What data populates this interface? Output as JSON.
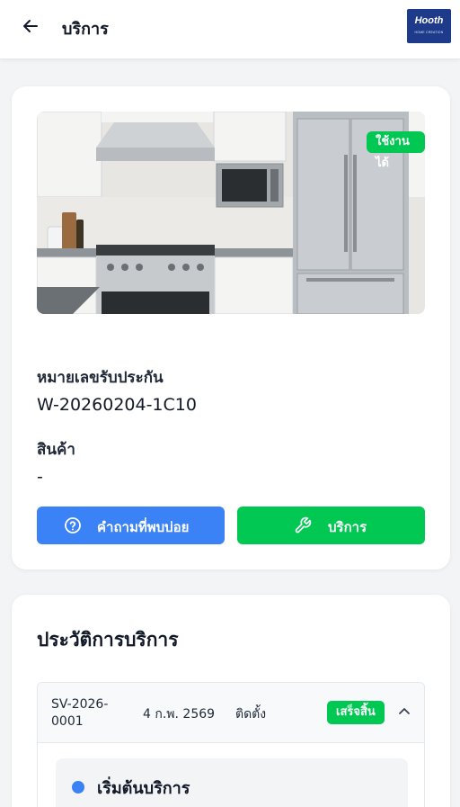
{
  "header": {
    "title": "บริการ",
    "back_icon": "arrow-left-icon",
    "logo_text": "Hooth",
    "logo_subtext": "HOME CREATION"
  },
  "product": {
    "status": "ใช้งานได้",
    "warranty_label": "หมายเลขรับประกัน",
    "warranty_number": "W-20260204-1C10",
    "product_label": "สินค้า",
    "product_value": "-",
    "faq_button": "คำถามที่พบบ่อย",
    "service_button": "บริการ"
  },
  "history": {
    "title": "ประวัติการบริการ",
    "records": [
      {
        "ticket": "SV-2026-0001",
        "date": "4 ก.พ. 2569",
        "type": "ติดตั้ง",
        "status": "เสร็จสิ้น",
        "steps": [
          {
            "title": "เริ่มต้นบริการ"
          }
        ]
      }
    ]
  },
  "colors": {
    "primary_blue": "#3b82f6",
    "success_green": "#00c853",
    "logo_navy": "#1e3a8a",
    "page_bg": "#f3f4f6"
  }
}
